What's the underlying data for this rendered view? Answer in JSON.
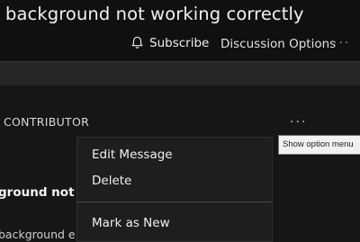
{
  "header": {
    "title": "background not working correctly",
    "subscribe_label": "Subscribe",
    "discussion_options_label": "Discussion Options",
    "more_dots": "···"
  },
  "post": {
    "role": "CONTRIBUTOR",
    "options_dots": "···",
    "title": "ground not w",
    "body": "background e"
  },
  "tooltip": {
    "text": "Show option menu"
  },
  "menu": {
    "items": [
      {
        "label": "Edit Message"
      },
      {
        "label": "Delete"
      },
      {
        "label": "Mark as New"
      }
    ]
  },
  "icons": {
    "subscribe": "bell-icon"
  }
}
